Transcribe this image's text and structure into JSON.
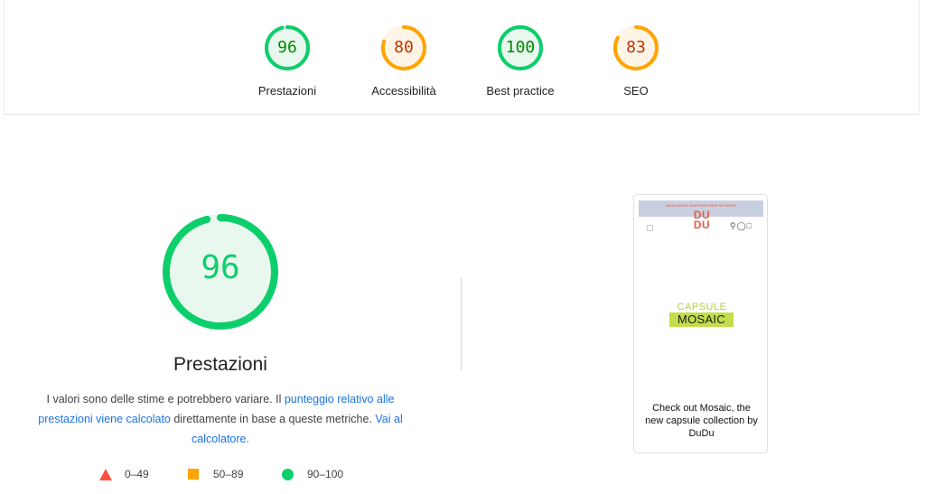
{
  "categories": [
    {
      "id": "performance",
      "score": "96",
      "score_value": 96,
      "label": "Prestazioni",
      "status": "pass"
    },
    {
      "id": "accessibility",
      "score": "80",
      "score_value": 80,
      "label": "Accessibilità",
      "status": "average"
    },
    {
      "id": "best-practices",
      "score": "100",
      "score_value": 100,
      "label": "Best practice",
      "status": "pass"
    },
    {
      "id": "seo",
      "score": "83",
      "score_value": 83,
      "label": "SEO",
      "status": "average"
    }
  ],
  "main": {
    "score": "96",
    "score_value": 96,
    "title": "Prestazioni",
    "desc_part1": "I valori sono delle stime e potrebbero variare. Il ",
    "desc_link1": "punteggio relativo alle prestazioni viene calcolato",
    "desc_part2": " direttamente in base a queste metriche. ",
    "desc_link2": "Vai al calcolatore."
  },
  "legend": [
    {
      "shape": "triangle",
      "range": "0–49",
      "color": "#ff4e42"
    },
    {
      "shape": "square",
      "range": "50–89",
      "color": "#ffa400"
    },
    {
      "shape": "circle",
      "range": "90–100",
      "color": "#0cce6b"
    }
  ],
  "screenshot": {
    "banner_text": "WORLDWIDE SHIPPING FREE RETURNS",
    "logo_line1": "DU",
    "logo_line2": "DU",
    "capsule_label": "CAPSULE",
    "mosaic_label": "MOSAIC",
    "caption": "Check out Mosaic, the new capsule collection by DuDu"
  },
  "colors": {
    "pass": "#0cce6b",
    "pass_bg": "#e9f8ef",
    "pass_text": "#008800",
    "average": "#ffa400",
    "average_bg": "#fff5e6",
    "average_text": "#c33300",
    "link": "#1a73e8"
  }
}
